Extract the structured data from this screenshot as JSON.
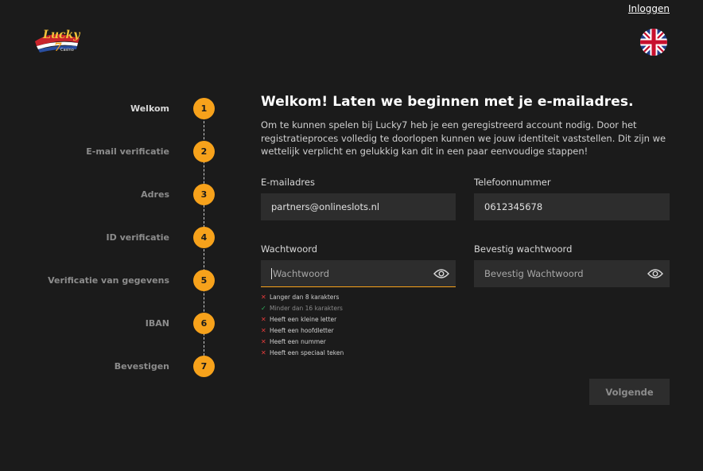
{
  "header": {
    "login_label": "Inloggen"
  },
  "steps": [
    {
      "num": "1",
      "label": "Welkom",
      "active": true
    },
    {
      "num": "2",
      "label": "E-mail verificatie"
    },
    {
      "num": "3",
      "label": "Adres"
    },
    {
      "num": "4",
      "label": "ID verificatie"
    },
    {
      "num": "5",
      "label": "Verificatie van gegevens"
    },
    {
      "num": "6",
      "label": "IBAN"
    },
    {
      "num": "7",
      "label": "Bevestigen"
    }
  ],
  "main": {
    "title": "Welkom! Laten we beginnen met je e-mailadres.",
    "intro": "Om te kunnen spelen bij Lucky7 heb je een geregistreerd account nodig. Door het registratieproces volledig te doorlopen kunnen we jouw identiteit vaststellen. Dit zijn we wettelijk verplicht en gelukkig kan dit in een paar eenvoudige stappen!"
  },
  "form": {
    "email": {
      "label": "E-mailadres",
      "value": "partners@onlineslots.nl"
    },
    "phone": {
      "label": "Telefoonnummer",
      "value": "0612345678"
    },
    "password": {
      "label": "Wachtwoord",
      "placeholder": "Wachtwoord"
    },
    "confirm": {
      "label": "Bevestig wachtwoord",
      "placeholder": "Bevestig Wachtwoord"
    },
    "rules": [
      {
        "text": "Langer dan 8 karakters",
        "ok": false
      },
      {
        "text": "Minder dan 16 karakters",
        "ok": true
      },
      {
        "text": "Heeft een kleine letter",
        "ok": false
      },
      {
        "text": "Heeft een hoofdletter",
        "ok": false
      },
      {
        "text": "Heeft een nummer",
        "ok": false
      },
      {
        "text": "Heeft een speciaal teken",
        "ok": false
      }
    ],
    "next_label": "Volgende"
  },
  "colors": {
    "accent": "#f7a21b",
    "background": "#1b1b1b",
    "input": "#2d2d2d",
    "error": "#e43b3b",
    "success": "#2fb35c"
  }
}
